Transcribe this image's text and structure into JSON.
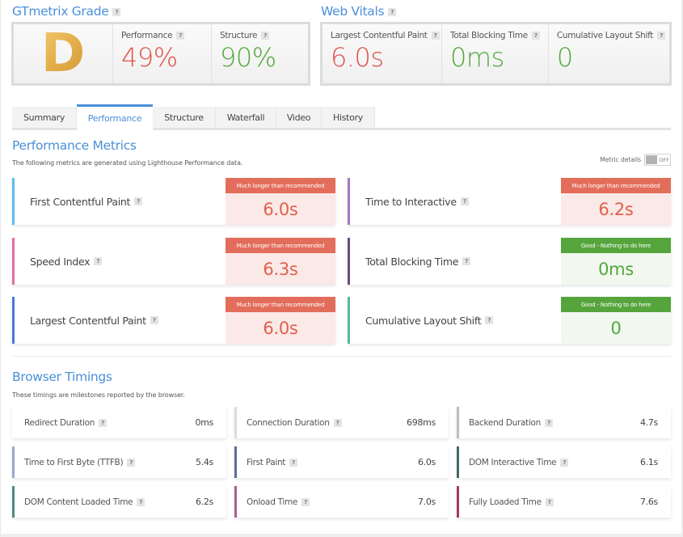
{
  "grade": {
    "title": "GTmetrix Grade",
    "letter": "D",
    "performance_label": "Performance",
    "performance_value": "49%",
    "structure_label": "Structure",
    "structure_value": "90%"
  },
  "web_vitals": {
    "title": "Web Vitals",
    "items": [
      {
        "label": "Largest Contentful Paint",
        "value": "6.0s",
        "status": "bad"
      },
      {
        "label": "Total Blocking Time",
        "value": "0ms",
        "status": "good"
      },
      {
        "label": "Cumulative Layout Shift",
        "value": "0",
        "status": "good"
      }
    ]
  },
  "tabs": [
    {
      "label": "Summary",
      "active": false
    },
    {
      "label": "Performance",
      "active": true
    },
    {
      "label": "Structure",
      "active": false
    },
    {
      "label": "Waterfall",
      "active": false
    },
    {
      "label": "Video",
      "active": false
    },
    {
      "label": "History",
      "active": false
    }
  ],
  "performance_metrics": {
    "title": "Performance Metrics",
    "description": "The following metrics are generated using Lighthouse Performance data.",
    "toggle_label": "Metric details",
    "toggle_state": "OFF",
    "metrics": [
      {
        "label": "First Contentful Paint",
        "value": "6.0s",
        "badge": "Much longer than recommended",
        "status": "bad",
        "color": "#5bbcf0"
      },
      {
        "label": "Time to Interactive",
        "value": "6.2s",
        "badge": "Much longer than recommended",
        "status": "bad",
        "color": "#a874cc"
      },
      {
        "label": "Speed Index",
        "value": "6.3s",
        "badge": "Much longer than recommended",
        "status": "bad",
        "color": "#e36ea4"
      },
      {
        "label": "Total Blocking Time",
        "value": "0ms",
        "badge": "Good - Nothing to do here",
        "status": "good",
        "color": "#6a4a86"
      },
      {
        "label": "Largest Contentful Paint",
        "value": "6.0s",
        "badge": "Much longer than recommended",
        "status": "bad",
        "color": "#4a78dc"
      },
      {
        "label": "Cumulative Layout Shift",
        "value": "0",
        "badge": "Good - Nothing to do here",
        "status": "good",
        "color": "#5ab79a"
      }
    ]
  },
  "browser_timings": {
    "title": "Browser Timings",
    "description": "These timings are milestones reported by the browser.",
    "items": [
      {
        "label": "Redirect Duration",
        "value": "0ms",
        "color": "#ffffff"
      },
      {
        "label": "Connection Duration",
        "value": "698ms",
        "color": "#dcdcdc"
      },
      {
        "label": "Backend Duration",
        "value": "4.7s",
        "color": "#bdbdbd"
      },
      {
        "label": "Time to First Byte (TTFB)",
        "value": "5.4s",
        "color": "#9aa6cc"
      },
      {
        "label": "First Paint",
        "value": "6.0s",
        "color": "#5a6e9a"
      },
      {
        "label": "DOM Interactive Time",
        "value": "6.1s",
        "color": "#456a6a"
      },
      {
        "label": "DOM Content Loaded Time",
        "value": "6.2s",
        "color": "#4f8a82"
      },
      {
        "label": "Onload Time",
        "value": "7.0s",
        "color": "#a8628c"
      },
      {
        "label": "Fully Loaded Time",
        "value": "7.6s",
        "color": "#a83a66"
      }
    ]
  },
  "help_icon_text": "?"
}
